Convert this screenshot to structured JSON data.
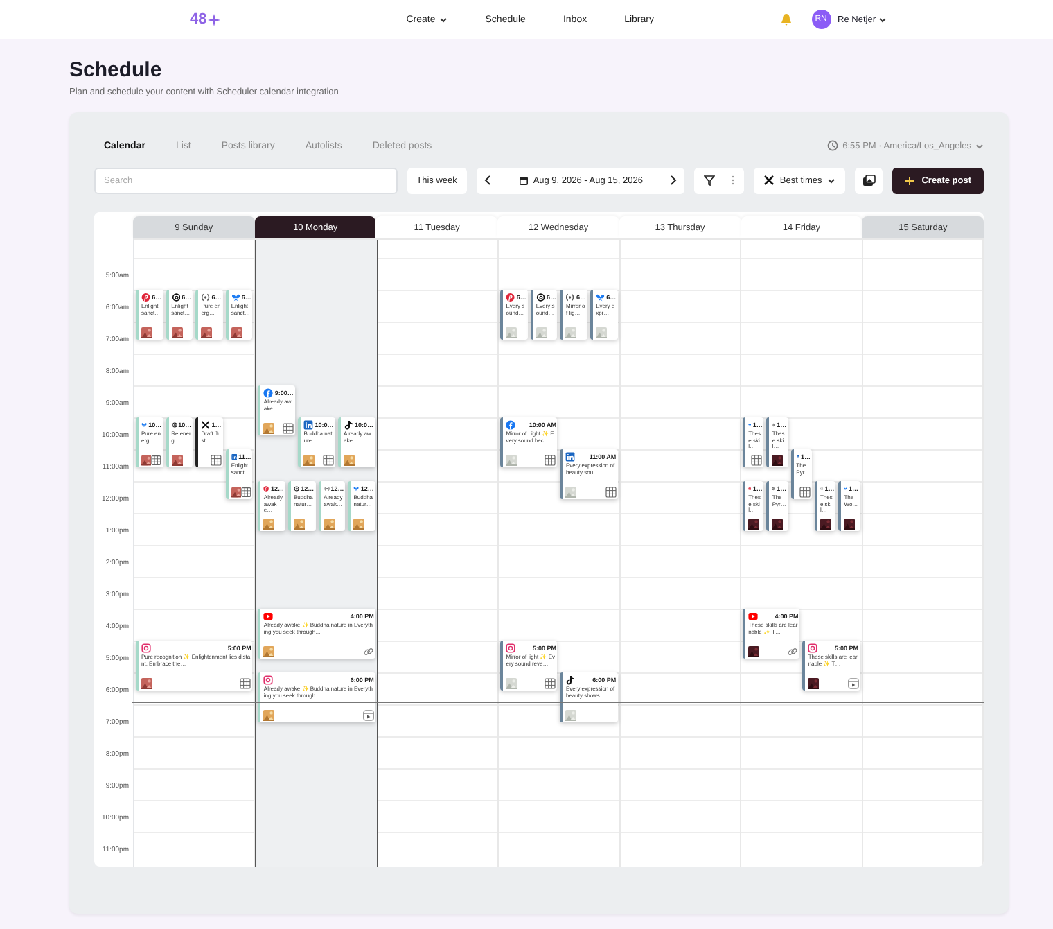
{
  "app": {
    "logo": "48",
    "nav": [
      {
        "label": "Create",
        "dropdown": true
      },
      {
        "label": "Schedule",
        "dropdown": false
      },
      {
        "label": "Inbox",
        "dropdown": false
      },
      {
        "label": "Library",
        "dropdown": false
      }
    ],
    "user": {
      "initials": "RN",
      "name": "Re Netjer",
      "dropdown": true
    }
  },
  "page": {
    "title": "Schedule",
    "subtitle": "Plan and schedule your content with Scheduler calendar integration"
  },
  "tabs": [
    {
      "label": "Calendar",
      "selected": true
    },
    {
      "label": "List",
      "selected": false
    },
    {
      "label": "Posts library",
      "selected": false
    },
    {
      "label": "Autolists",
      "selected": false
    },
    {
      "label": "Deleted posts",
      "selected": false
    }
  ],
  "clock": {
    "time": "6:55 PM",
    "separator": "·",
    "zone": "America/Los_Angeles"
  },
  "toolbar": {
    "search_placeholder": "Search",
    "range_button": "This week",
    "date_range": "Aug 9, 2026 - Aug 15, 2026",
    "best_times": "Best times",
    "create": "Create post"
  },
  "days": [
    {
      "label": "9 Sunday",
      "selected": false,
      "weekend": true
    },
    {
      "label": "10 Monday",
      "selected": true,
      "weekend": false
    },
    {
      "label": "11 Tuesday",
      "selected": false,
      "weekend": false
    },
    {
      "label": "12 Wednesday",
      "selected": false,
      "weekend": false
    },
    {
      "label": "13 Thursday",
      "selected": false,
      "weekend": false
    },
    {
      "label": "14 Friday",
      "selected": false,
      "weekend": false
    },
    {
      "label": "15 Saturday",
      "selected": false,
      "weekend": true
    }
  ],
  "hours": [
    {
      "label": "5:00am"
    },
    {
      "label": "6:00am",
      "slots": [
        {
          "kind": "sun",
          "events": [
            {
              "kind": "pinterest",
              "time": "6…",
              "text": "Enlight sanct…",
              "thumb": true,
              "color": "#a6d9c9"
            },
            {
              "kind": "threads",
              "time": "6…",
              "text": "Enlight sanct…",
              "thumb": true,
              "color": "#a6d9c9"
            },
            {
              "kind": "mastodon",
              "time": "6…",
              "text": "Pure energ…",
              "thumb": true,
              "color": "#a6d9c9"
            },
            {
              "kind": "bluesky",
              "time": "6…",
              "text": "Enlight sanct…",
              "thumb": true,
              "color": "#a6d9c9"
            }
          ]
        },
        {
          "kind": "wed",
          "events": [
            {
              "kind": "pinterest",
              "time": "6…",
              "text": "Every sound…",
              "thumb": true,
              "color": "#6b859b"
            },
            {
              "kind": "threads",
              "time": "6…",
              "text": "Every sound…",
              "thumb": true,
              "color": "#6b859b"
            },
            {
              "kind": "mastodon",
              "time": "6…",
              "text": "Mirror of lig…",
              "thumb": true,
              "color": "#6b859b"
            },
            {
              "kind": "bluesky",
              "time": "6…",
              "text": "Every expr…",
              "thumb": true,
              "color": "#6b859b"
            }
          ]
        }
      ]
    },
    {
      "label": "7:00am"
    },
    {
      "label": "8:00am"
    },
    {
      "label": "9:00am",
      "slots": [
        {
          "kind": "mon",
          "events": [
            {
              "kind": "facebook",
              "time": "9:00…",
              "text": "Already awake…",
              "thumb": true,
              "extra": {
                "kind": "grid"
              },
              "color": "#a6d9c9"
            }
          ]
        }
      ]
    },
    {
      "label": "10:00am",
      "slots": [
        {
          "kind": "sun",
          "events": [
            {
              "kind": "bluesky",
              "time": "10…",
              "text": "Pure energ…",
              "thumb": true,
              "extra": {
                "kind": "grid"
              },
              "color": "#a6d9c9"
            },
            {
              "kind": "threads",
              "time": "10…",
              "text": "Re energ…",
              "thumb": true,
              "color": "#a6d9c9"
            },
            {
              "kind": "x",
              "time": "1…",
              "text": "Draft Just…",
              "thumb": false,
              "extra": {
                "kind": "grid"
              },
              "color": "#222222"
            }
          ]
        },
        {
          "kind": "mon",
          "events": [
            {
              "kind": "linkedin",
              "time": "10:0…",
              "text": "Buddha nature…",
              "thumb": true,
              "extra": {
                "kind": "grid"
              },
              "color": "#a6d9c9"
            },
            {
              "kind": "tiktok",
              "time": "10:0…",
              "text": "Already awake…",
              "thumb": true,
              "color": "#a6d9c9"
            }
          ]
        },
        {
          "kind": "wed",
          "events": [
            {
              "kind": "facebook",
              "time": "10:00 AM",
              "text": "Mirror of Light ✨ Every sound bec…",
              "thumb": true,
              "extra": {
                "kind": "grid"
              },
              "color": "#6b859b"
            }
          ]
        },
        {
          "kind": "fri",
          "events": [
            {
              "kind": "bluesky",
              "time": "1…",
              "text": "These skil…",
              "thumb": false,
              "extra": {
                "kind": "grid"
              },
              "color": "#6b859b"
            },
            {
              "kind": "threads",
              "time": "1…",
              "text": "These skil…",
              "thumb": true,
              "color": "#6b859b"
            }
          ]
        }
      ]
    },
    {
      "label": "11:00am",
      "slots": [
        {
          "kind": "sun",
          "events": [
            {
              "kind": "linkedin",
              "time": "11…",
              "text": "Enlight sanct…",
              "thumb": true,
              "extra": {
                "kind": "grid"
              },
              "color": "#a6d9c9"
            }
          ]
        },
        {
          "kind": "wed",
          "events": [
            {
              "kind": "linkedin",
              "time": "11:00 AM",
              "text": "Every expression of beauty sou…",
              "thumb": true,
              "extra": {
                "kind": "grid"
              },
              "color": "#6b859b"
            }
          ]
        },
        {
          "kind": "fri",
          "events": [
            {
              "kind": "linkedin",
              "time": "1…",
              "text": "The Pyr…",
              "thumb": false,
              "extra": {
                "kind": "grid"
              },
              "color": "#6b859b"
            }
          ]
        }
      ]
    },
    {
      "label": "12:00pm",
      "slots": [
        {
          "kind": "mon",
          "events": [
            {
              "kind": "pinterest",
              "time": "12…",
              "text": "Already awake…",
              "thumb": true,
              "color": "#a6d9c9"
            },
            {
              "kind": "threads",
              "time": "12…",
              "text": "Buddha natur…",
              "thumb": true,
              "color": "#a6d9c9"
            },
            {
              "kind": "mastodon",
              "time": "12…",
              "text": "Already awak…",
              "thumb": true,
              "color": "#a6d9c9"
            },
            {
              "kind": "bluesky",
              "time": "12…",
              "text": "Buddha natur…",
              "thumb": true,
              "color": "#a6d9c9"
            }
          ]
        },
        {
          "kind": "fri",
          "events": [
            {
              "kind": "pinterest",
              "time": "1…",
              "text": "These skil…",
              "thumb": true,
              "color": "#6b859b"
            },
            {
              "kind": "threads",
              "time": "1…",
              "text": "The Pyr…",
              "thumb": true,
              "color": "#6b859b"
            },
            {
              "kind": "mastodon",
              "time": "1…",
              "text": "These skil…",
              "thumb": true,
              "color": "#6b859b"
            },
            {
              "kind": "bluesky",
              "time": "1…",
              "text": "The Wo…",
              "thumb": true,
              "color": "#6b859b"
            }
          ]
        }
      ]
    },
    {
      "label": "1:00pm"
    },
    {
      "label": "2:00pm"
    },
    {
      "label": "3:00pm"
    },
    {
      "label": "4:00pm",
      "slots": [
        {
          "kind": "mon",
          "events": [
            {
              "kind": "youtube",
              "time": "4:00 PM",
              "text": "Already awake ✨ Buddha nature in Everything you seek through…",
              "thumb": true,
              "extra": {
                "kind": "link"
              },
              "color": "#a6d9c9"
            }
          ]
        },
        {
          "kind": "fri",
          "events": [
            {
              "kind": "youtube",
              "time": "4:00 PM",
              "text": "These skills are learnable ✨ T…",
              "thumb": true,
              "extra": {
                "kind": "link"
              },
              "color": "#6b859b"
            }
          ]
        }
      ]
    },
    {
      "label": "5:00pm",
      "slots": [
        {
          "kind": "sun",
          "events": [
            {
              "kind": "instagram",
              "time": "5:00 PM",
              "text": "Pure recognition ✨ Enlightenment lies distant. Embrace the…",
              "thumb": true,
              "extra": {
                "kind": "grid"
              },
              "color": "#a6d9c9"
            }
          ]
        },
        {
          "kind": "wed",
          "events": [
            {
              "kind": "instagram",
              "time": "5:00 PM",
              "text": "Mirror of light ✨ Every sound reve…",
              "thumb": true,
              "extra": {
                "kind": "grid"
              },
              "color": "#6b859b"
            }
          ]
        },
        {
          "kind": "fri",
          "events": [
            {
              "kind": "instagram",
              "time": "5:00 PM",
              "text": "These skills are learnable ✨ T…",
              "thumb": true,
              "extra": {
                "kind": "reel"
              },
              "color": "#6b859b"
            }
          ]
        }
      ]
    },
    {
      "label": "6:00pm",
      "slots": [
        {
          "kind": "mon",
          "events": [
            {
              "kind": "instagram",
              "time": "6:00 PM",
              "text": "Already awake ✨ Buddha nature in Everything you seek through…",
              "thumb": true,
              "extra": {
                "kind": "reel"
              },
              "color": "#a6d9c9"
            }
          ]
        },
        {
          "kind": "wed",
          "events": [
            {
              "kind": "tiktok",
              "time": "6:00 PM",
              "text": "Every expression of beauty shows…",
              "thumb": true,
              "color": "#6b859b"
            }
          ]
        }
      ]
    },
    {
      "label": "7:00pm"
    },
    {
      "label": "8:00pm"
    },
    {
      "label": "9:00pm"
    },
    {
      "label": "10:00pm"
    },
    {
      "label": "11:00pm"
    }
  ]
}
